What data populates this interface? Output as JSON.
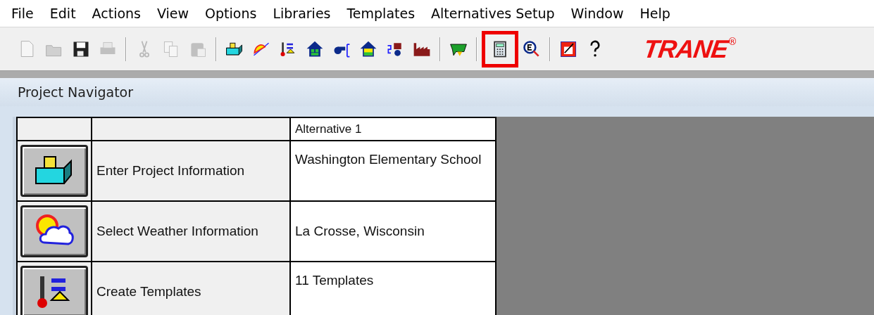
{
  "menu": [
    "File",
    "Edit",
    "Actions",
    "View",
    "Options",
    "Libraries",
    "Templates",
    "Alternatives Setup",
    "Window",
    "Help"
  ],
  "toolbar": [
    [
      {
        "kind": "new",
        "disabled": true,
        "highlighted": false
      },
      {
        "kind": "open",
        "disabled": true,
        "highlighted": false
      },
      {
        "kind": "save",
        "disabled": false,
        "highlighted": false
      },
      {
        "kind": "print",
        "disabled": true,
        "highlighted": false
      }
    ],
    [
      {
        "kind": "cut",
        "disabled": true,
        "highlighted": false
      },
      {
        "kind": "copy",
        "disabled": true,
        "highlighted": false
      },
      {
        "kind": "paste",
        "disabled": true,
        "highlighted": false
      }
    ],
    [
      {
        "kind": "project",
        "disabled": false,
        "highlighted": false
      },
      {
        "kind": "weather",
        "disabled": false,
        "highlighted": false
      },
      {
        "kind": "templates",
        "disabled": false,
        "highlighted": false
      },
      {
        "kind": "rooms",
        "disabled": false,
        "highlighted": false
      },
      {
        "kind": "systems",
        "disabled": false,
        "highlighted": false
      },
      {
        "kind": "zones",
        "disabled": false,
        "highlighted": false
      },
      {
        "kind": "coils",
        "disabled": false,
        "highlighted": false
      },
      {
        "kind": "plants",
        "disabled": false,
        "highlighted": false
      }
    ],
    [
      {
        "kind": "economics",
        "disabled": false,
        "highlighted": false
      }
    ],
    [
      {
        "kind": "calculate",
        "disabled": false,
        "highlighted": true
      },
      {
        "kind": "reports",
        "disabled": false,
        "highlighted": false
      }
    ],
    [
      {
        "kind": "graph",
        "disabled": false,
        "highlighted": false
      },
      {
        "kind": "help",
        "disabled": false,
        "highlighted": false
      }
    ]
  ],
  "logo": {
    "text": "TRANE",
    "mark": "®"
  },
  "window": {
    "title": "Project Navigator"
  },
  "table": {
    "column_3": "Alternative 1",
    "rows": [
      {
        "kind": "project",
        "label": "Enter Project Information",
        "value": "Washington Elementary School"
      },
      {
        "kind": "weather",
        "label": "Select Weather Information",
        "value": "La Crosse, Wisconsin"
      },
      {
        "kind": "templates",
        "label": "Create Templates",
        "value": "11 Templates"
      }
    ]
  }
}
